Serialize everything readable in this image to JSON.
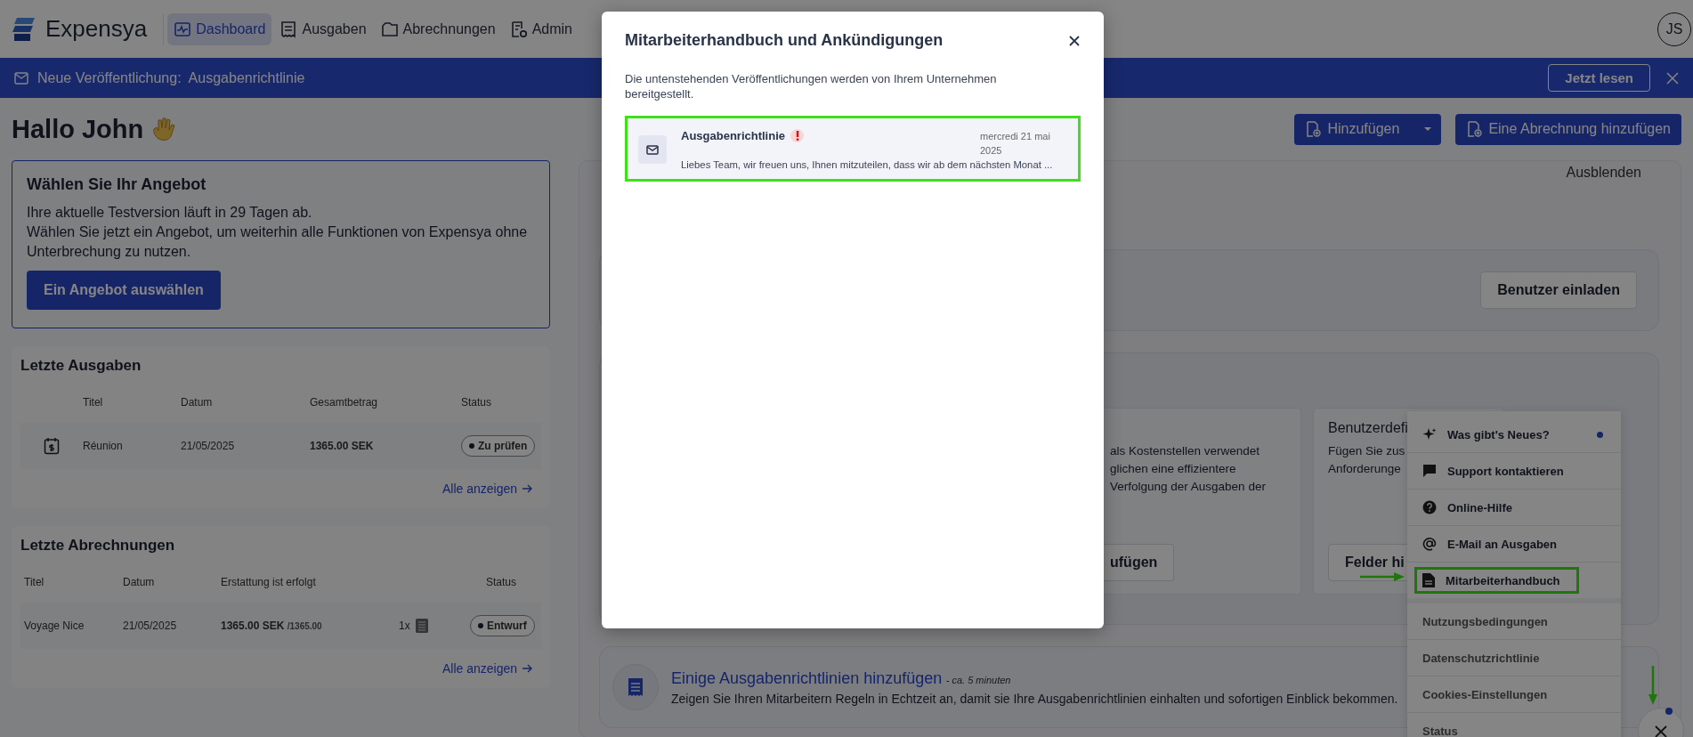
{
  "header": {
    "logo_text": "Expensya",
    "nav": [
      {
        "label": "Dashboard",
        "selected": true
      },
      {
        "label": "Ausgaben",
        "selected": false
      },
      {
        "label": "Abrechnungen",
        "selected": false
      },
      {
        "label": "Admin",
        "selected": false
      }
    ],
    "avatar": "JS"
  },
  "banner": {
    "text": "Neue Veröffentlichung:  Ausgabenrichtlinie",
    "button": "Jetzt lesen"
  },
  "greeting": "Hallo John",
  "actions": [
    {
      "label": "Hinzufügen",
      "dropdown": true
    },
    {
      "label": "Eine Abrechnung hinzufügen",
      "dropdown": false
    }
  ],
  "offer": {
    "title": "Wählen Sie Ihr Angebot",
    "lines": [
      "Ihre aktuelle Testversion läuft in 29 Tagen ab.",
      "Wählen Sie jetzt ein Angebot, um weiterhin alle Funktionen von Expensya ohne Unterbrechung zu nutzen."
    ],
    "button": "Ein Angebot auswählen"
  },
  "recent_expenses": {
    "title": "Letzte Ausgaben",
    "columns": [
      "Titel",
      "Datum",
      "Gesamtbetrag",
      "Status"
    ],
    "rows": [
      {
        "title": "Réunion",
        "date": "21/05/2025",
        "amount": "1365.00 SEK",
        "status": "Zu prüfen"
      }
    ],
    "link": "Alle anzeigen"
  },
  "recent_reports": {
    "title": "Letzte Abrechnungen",
    "columns": [
      "Titel",
      "Datum",
      "Erstattung ist erfolgt",
      "Status"
    ],
    "rows": [
      {
        "title": "Voyage Nice",
        "date": "21/05/2025",
        "amount": "1365.00 SEK",
        "total": "/1365.00",
        "count": "1x",
        "status": "Entwurf"
      }
    ],
    "link": "Alle anzeigen"
  },
  "onboarding": {
    "hide": "Ausblenden",
    "invite_button": "Benutzer einladen",
    "cards": [
      {
        "lines": [
          "als Kostenstellen verwendet",
          "glichen eine effizientere",
          "Verfolgung der Ausgaben der"
        ],
        "button": "ufügen"
      },
      {
        "title": "Benutzerdefi",
        "lines": [
          "Fügen Sie zus",
          "Anforderunge"
        ],
        "button": "Felder hi"
      }
    ],
    "policy": {
      "title": "Einige Ausgabenrichtlinien hinzufügen",
      "duration": "- ca. 5 minuten",
      "description": "Zeigen Sie Ihren Mitarbeitern Regeln in Echtzeit an, damit sie Ihre Ausgabenrichtlinien einhalten und sofortigen Einblick bekommen."
    }
  },
  "help_menu": {
    "items": [
      {
        "label": "Was gibt's Neues?",
        "kind": "primary",
        "new": true,
        "highlighted": false
      },
      {
        "label": "Support kontaktieren",
        "kind": "primary",
        "new": false,
        "highlighted": false
      },
      {
        "label": "Online-Hilfe",
        "kind": "primary",
        "new": false,
        "highlighted": false
      },
      {
        "label": "E-Mail an Ausgaben",
        "kind": "primary",
        "new": false,
        "highlighted": false
      },
      {
        "label": "Mitarbeiterhandbuch",
        "kind": "primary",
        "new": false,
        "highlighted": true
      },
      {
        "label": "Nutzungsbedingungen",
        "kind": "secondary",
        "new": false,
        "highlighted": false
      },
      {
        "label": "Datenschutzrichtlinie",
        "kind": "secondary",
        "new": false,
        "highlighted": false
      },
      {
        "label": "Cookies-Einstellungen",
        "kind": "secondary",
        "new": false,
        "highlighted": false
      },
      {
        "label": "Status",
        "kind": "secondary",
        "new": false,
        "highlighted": false
      }
    ],
    "notification": true
  },
  "modal": {
    "title": "Mitarbeiterhandbuch und Ankündigungen",
    "description": "Die untenstehenden Veröffentlichungen werden von Ihrem Unternehmen bereitgestellt.",
    "items": [
      {
        "title": "Ausgabenrichtlinie",
        "important": true,
        "date": "mercredi 21 mai 2025",
        "excerpt": "Liebes Team, wir freuen uns, Ihnen mitzuteilen, dass wir ab dem nächsten Monat ...",
        "highlighted": true
      }
    ]
  }
}
